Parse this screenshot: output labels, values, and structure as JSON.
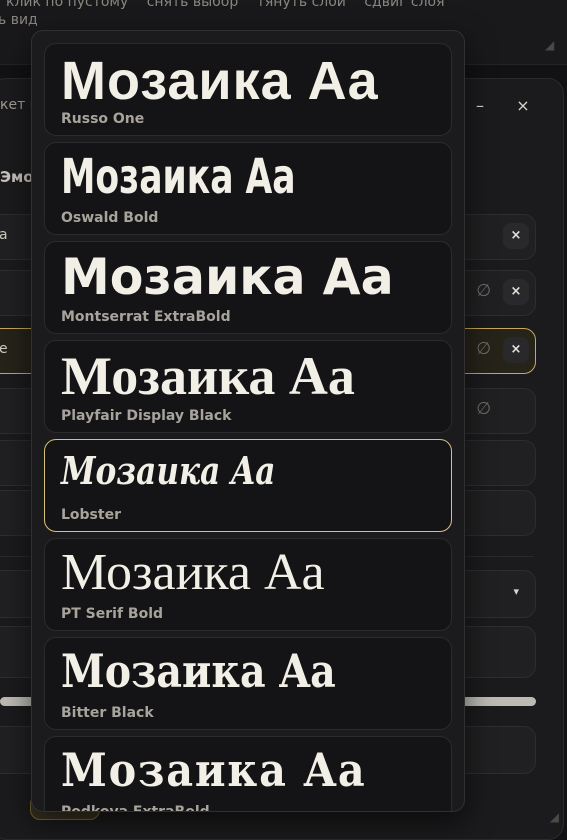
{
  "hints": {
    "line1": [
      "клик по пустому",
      "снять выбор",
      "тянуть слой",
      "сдвиг слоя"
    ],
    "line2": "ь вид"
  },
  "panel": {
    "title": "кет и",
    "minimize": "–",
    "close": "×",
    "section": "Эмо"
  },
  "layers": [
    {
      "text": "a",
      "remove": "×",
      "hide": ""
    },
    {
      "text": "",
      "remove": "×",
      "hide": "∅"
    },
    {
      "text": "e",
      "remove": "×",
      "hide": "∅"
    },
    {
      "text": "",
      "remove": "",
      "hide": "∅"
    },
    {
      "text": "",
      "remove": "",
      "hide": ""
    },
    {
      "text": "",
      "remove": "",
      "hide": ""
    }
  ],
  "select": {
    "arrow": "▾"
  },
  "slider": {
    "value_fraction": 1.0
  },
  "font_dropdown": {
    "selected_font": "Lobster",
    "options": [
      {
        "preview": "Мозаика Aa",
        "name": "Russo One"
      },
      {
        "preview": "Мозаика Aa",
        "name": "Oswald Bold"
      },
      {
        "preview": "Мозаика Aa",
        "name": "Montserrat ExtraBold"
      },
      {
        "preview": "Мозаика Aa",
        "name": "Playfair Display Black"
      },
      {
        "preview": "Мозаика Aa",
        "name": "Lobster"
      },
      {
        "preview": "Мозаика Aa",
        "name": "PT Serif Bold"
      },
      {
        "preview": "Мозаика Aa",
        "name": "Bitter Black"
      },
      {
        "preview": "Мозаика Aa",
        "name": "Podkova ExtraBold"
      }
    ]
  },
  "colors": {
    "accent_gold": "#d8c27a",
    "background": "#121214",
    "panel": "#1b1b1d"
  }
}
